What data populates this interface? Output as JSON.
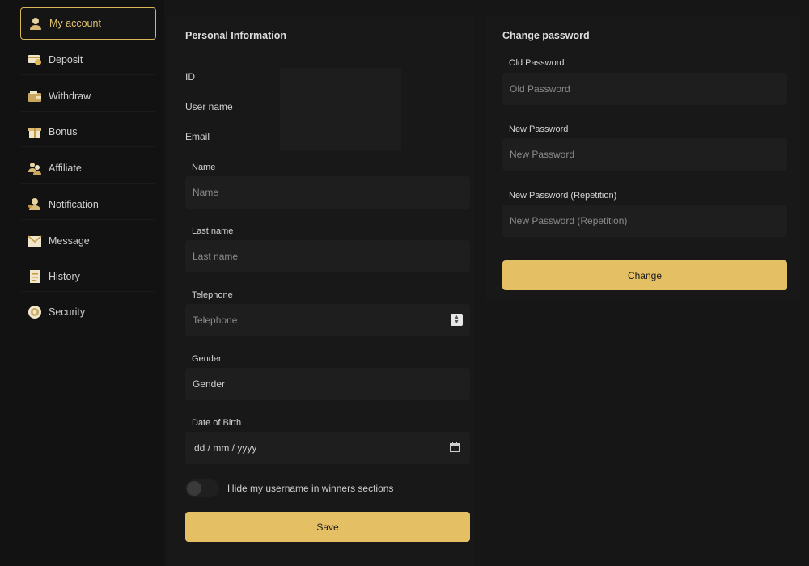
{
  "sidebar": {
    "items": [
      {
        "label": "My account",
        "icon": "user-icon",
        "active": true
      },
      {
        "label": "Deposit",
        "icon": "deposit-icon"
      },
      {
        "label": "Withdraw",
        "icon": "wallet-icon"
      },
      {
        "label": "Bonus",
        "icon": "gift-icon"
      },
      {
        "label": "Affiliate",
        "icon": "users-icon"
      },
      {
        "label": "Notification",
        "icon": "bell-user-icon"
      },
      {
        "label": "Message",
        "icon": "envelope-icon"
      },
      {
        "label": "History",
        "icon": "document-icon"
      },
      {
        "label": "Security",
        "icon": "shield-icon"
      }
    ]
  },
  "personal": {
    "title": "Personal Information",
    "id_label": "ID",
    "username_label": "User name",
    "email_label": "Email",
    "name": {
      "label": "Name",
      "placeholder": "Name"
    },
    "last_name": {
      "label": "Last name",
      "placeholder": "Last name"
    },
    "telephone": {
      "label": "Telephone",
      "placeholder": "Telephone"
    },
    "gender": {
      "label": "Gender",
      "value": "Gender"
    },
    "dob": {
      "label": "Date of Birth",
      "value": "dd / mm / yyyy"
    },
    "hide_toggle_label": "Hide my username in winners sections",
    "save_label": "Save"
  },
  "password": {
    "title": "Change password",
    "old": {
      "label": "Old Password",
      "placeholder": "Old Password"
    },
    "new": {
      "label": "New Password",
      "placeholder": "New Password"
    },
    "repeat": {
      "label": "New Password (Repetition)",
      "placeholder": "New Password (Repetition)"
    },
    "change_label": "Change"
  },
  "colors": {
    "accent": "#e4bf63",
    "background": "#121212",
    "panel": "#181818"
  }
}
